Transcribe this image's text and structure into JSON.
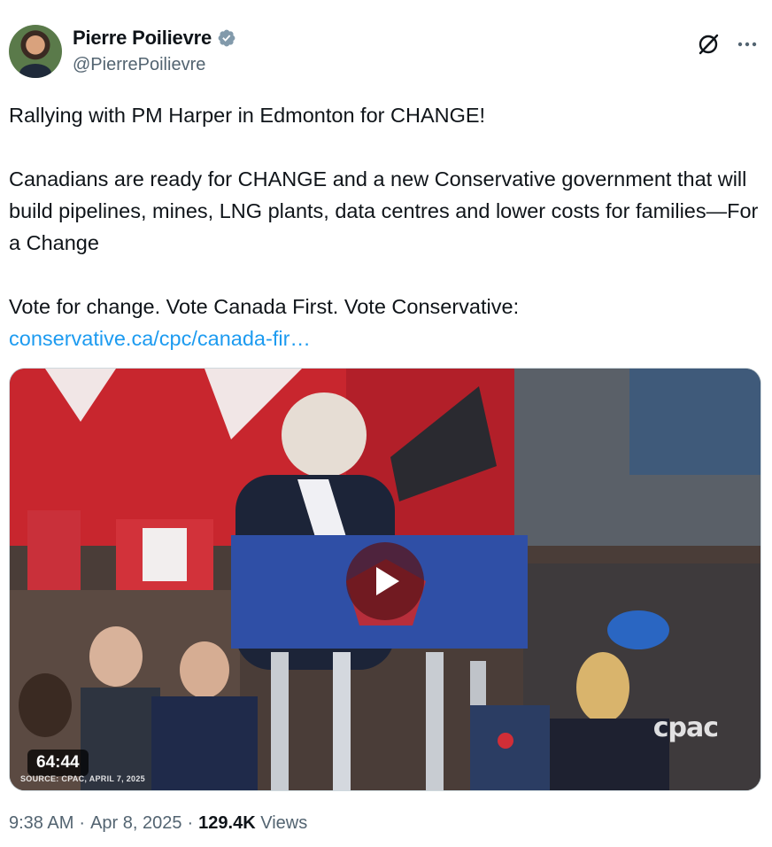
{
  "author": {
    "name": "Pierre Poilievre",
    "handle": "@PierrePoilievre",
    "verified_color": "#829aab"
  },
  "tweet": {
    "line1": "Rallying with PM Harper in Edmonton for CHANGE!",
    "line2": "Canadians are ready for CHANGE and a new Conservative government that will build pipelines, mines, LNG plants, data centres and lower costs for families—For a Change",
    "line3": "Vote for change. Vote Canada First. Vote Conservative:",
    "link": "conservative.ca/cpc/canada-fir…"
  },
  "video": {
    "duration": "64:44",
    "source": "SOURCE: CPAC, APRIL 7, 2025",
    "watermark": "cpac",
    "play_icon": "play-icon"
  },
  "meta": {
    "time": "9:38 AM",
    "separator": "·",
    "date": "Apr 8, 2025",
    "views_count": "129.4K",
    "views_label": "Views"
  },
  "colors": {
    "text": "#0f1419",
    "secondary": "#536471",
    "link": "#1d9bf0"
  }
}
